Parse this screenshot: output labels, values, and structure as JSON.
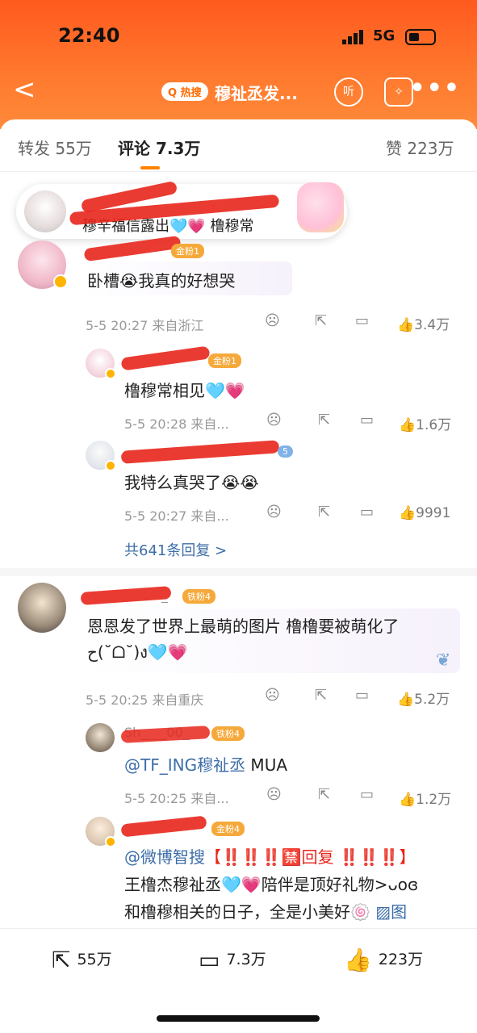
{
  "status": {
    "time": "22:40",
    "network": "5G"
  },
  "nav": {
    "back": "<",
    "hot_badge": "Q 热搜",
    "title": "穆祉丞发...",
    "listen": "听",
    "search_icon": "ai-search-icon",
    "more": "•••"
  },
  "tabs": {
    "repost": "转发 55万",
    "comment": "评论 7.3万",
    "like": "赞 223万"
  },
  "float_card": {
    "text": "穆辛福信露出🩵💗 橹穆常"
  },
  "comments": [
    {
      "fan_badge": "金粉1",
      "text": "卧槽😭我真的好想哭",
      "meta": "5-5 20:27 来自浙江",
      "likes": "3.4万",
      "replies": [
        {
          "fan_badge": "金粉1",
          "text": "橹穆常相见🩵💗",
          "meta": "5-5 20:28 来自...",
          "likes": "1.6万"
        },
        {
          "fan_badge": "5",
          "text": "我特么真哭了😭😭",
          "meta": "5-5 20:27 来自...",
          "likes": "9991"
        }
      ],
      "more_replies": "共641条回复 >"
    },
    {
      "name_suffix": "_",
      "fan_badge": "铁粉4",
      "text_line1": "恩恩发了世界上最萌的图片 橹橹要被萌化了",
      "text_line2": "ح(˘ᗝ˘)ง🩵💗",
      "meta": "5-5 20:25 来自重庆",
      "likes": "5.2万",
      "replies": [
        {
          "name": "Sh____00_",
          "fan_badge": "铁粉4",
          "mention": "@TF_ING穆祉丞",
          "text": " MUA",
          "meta": "5-5 20:25 来自...",
          "likes": "1.2万"
        },
        {
          "fan_badge": "金粉4",
          "mention": "@微博智搜",
          "line1_rest": "【‼️‼️‼️🈲回复 ‼️‼️‼️】",
          "line2": "王橹杰穆祉丞🩵💗陪伴是顶好礼物>ᴗoɞ",
          "line3": "和橹穆相关的日子，全是小美好🍥",
          "line3_link": "▨图"
        }
      ]
    }
  ],
  "bottom": {
    "repost": "55万",
    "comment": "7.3万",
    "like": "223万"
  }
}
